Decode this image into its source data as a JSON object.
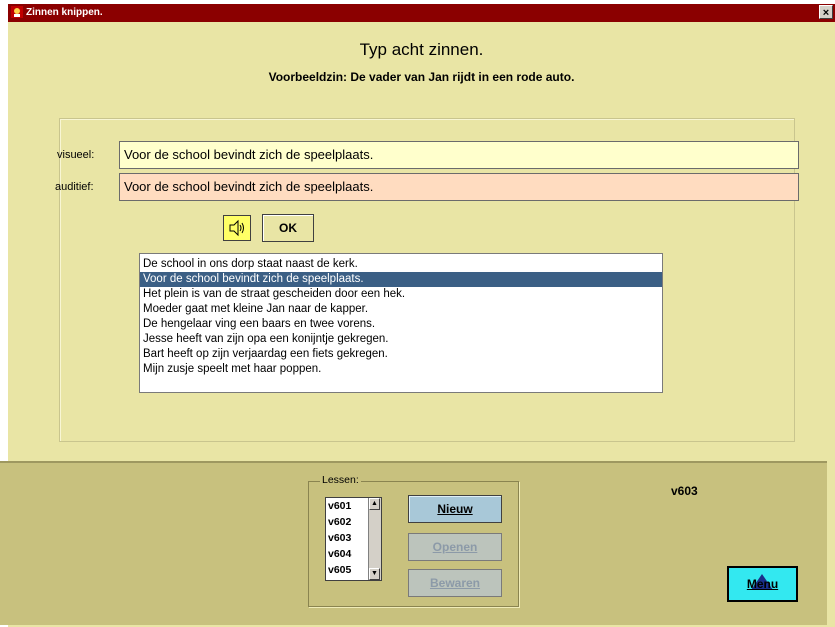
{
  "window": {
    "title": "Zinnen knippen."
  },
  "heading": "Typ acht zinnen.",
  "example": "Voorbeeldzin: De vader van Jan rijdt in een rode auto.",
  "fields": {
    "visual_label": "visueel:",
    "visual_value": "Voor de school bevindt zich de speelplaats.",
    "auditory_label": "auditief:",
    "auditory_value": "Voor de school bevindt zich de speelplaats."
  },
  "ok_label": "OK",
  "sentences": [
    "De school in ons dorp staat naast de kerk.",
    "Voor de school bevindt zich de speelplaats.",
    "Het plein is van de straat gescheiden door een hek.",
    "Moeder gaat met kleine Jan naar de kapper.",
    "De hengelaar ving een baars en twee vorens.",
    "Jesse heeft van zijn opa een konijntje gekregen.",
    "Bart heeft op zijn verjaardag een fiets gekregen.",
    "Mijn zusje speelt met haar poppen."
  ],
  "selected_sentence": 1,
  "lessons": {
    "title": "Lessen:",
    "items": [
      "v601",
      "v602",
      "v603",
      "v604",
      "v605"
    ]
  },
  "buttons": {
    "new": "Nieuw",
    "open": "Openen",
    "save": "Bewaren"
  },
  "current_lesson": "v603",
  "menu_label": "Menu",
  "colors": {
    "background": "#e9e5a5",
    "bottom_bar": "#c8c17e",
    "selection": "#3b5f85",
    "menu_button": "#33e8f0"
  }
}
